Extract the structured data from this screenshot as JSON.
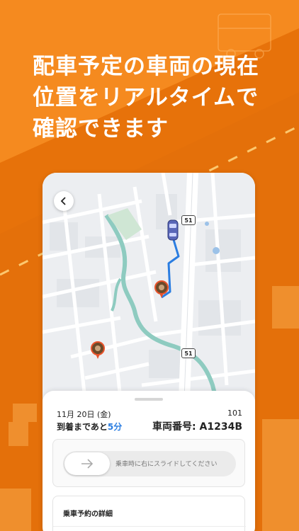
{
  "headline": {
    "line1": "配車予定の車両の現在",
    "line2": "位置をリアルタイムで",
    "line3": "確認できます"
  },
  "map": {
    "route_badges": [
      "51",
      "51"
    ]
  },
  "sheet": {
    "date": "11月 20日 (金)",
    "vehicle_count": "101",
    "arrival_prefix": "到着まであと",
    "arrival_minutes": "5分",
    "vehicle_number": "車両番号: A1234B",
    "slider_text": "乗車時に右にスライドしてください",
    "details_title": "乗車予約の詳細"
  },
  "colors": {
    "brand_orange": "#ef7d12",
    "route_blue": "#2a7de1",
    "pin_red": "#e8532b"
  },
  "icons": [
    "back-arrow-icon",
    "car-icon",
    "pickup-pin-icon",
    "destination-pin-icon",
    "slide-arrow-icon"
  ]
}
